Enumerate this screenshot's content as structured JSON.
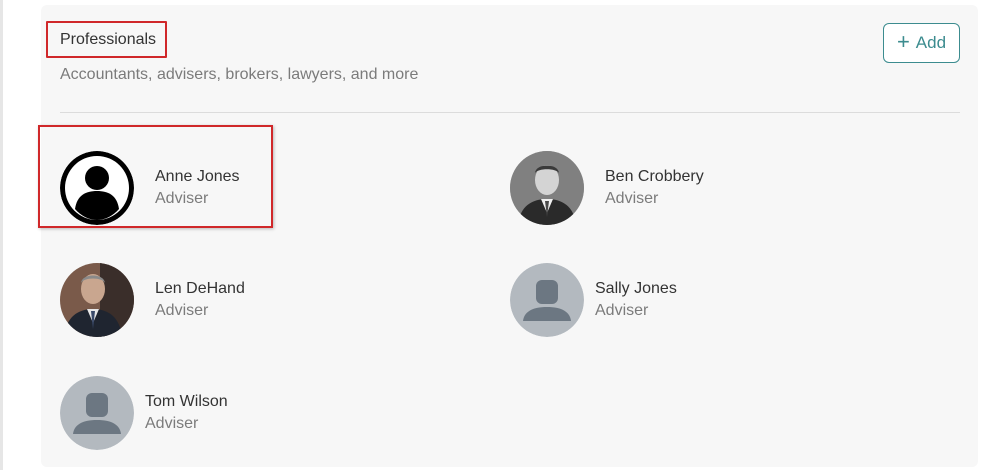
{
  "section": {
    "title": "Professionals",
    "subtitle": "Accountants, advisers, brokers, lawyers, and more",
    "add_label": "Add",
    "add_icon": "plus-icon"
  },
  "people": [
    {
      "name": "Anne Jones",
      "role": "Adviser",
      "avatar": "default-user-icon"
    },
    {
      "name": "Ben Crobbery",
      "role": "Adviser",
      "avatar": "photo"
    },
    {
      "name": "Len DeHand",
      "role": "Adviser",
      "avatar": "photo"
    },
    {
      "name": "Sally Jones",
      "role": "Adviser",
      "avatar": "placeholder-person-icon"
    },
    {
      "name": "Tom Wilson",
      "role": "Adviser",
      "avatar": "placeholder-person-icon"
    }
  ],
  "colors": {
    "accent": "#3c8c8f",
    "highlight": "#d0282a",
    "card_bg": "#f7f7f7",
    "placeholder_bg": "#b3b9bf",
    "placeholder_fg": "#6c7782"
  }
}
